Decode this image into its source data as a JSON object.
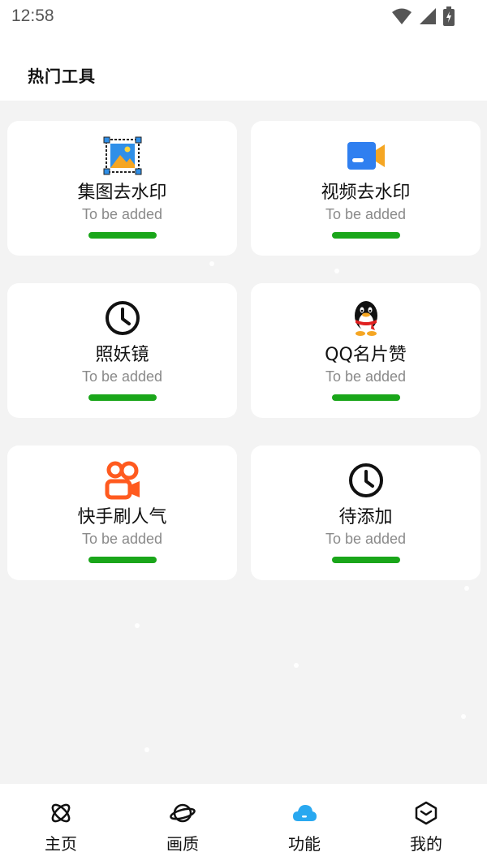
{
  "status": {
    "time": "12:58"
  },
  "header": {
    "title": "热门工具"
  },
  "cards": [
    {
      "title": "集图去水印",
      "subtitle": "To be added",
      "icon": "image-watermark-icon"
    },
    {
      "title": "视频去水印",
      "subtitle": "To be added",
      "icon": "video-camera-icon"
    },
    {
      "title": "照妖镜",
      "subtitle": "To be added",
      "icon": "clock-icon"
    },
    {
      "title": "QQ名片赞",
      "subtitle": "To be added",
      "icon": "qq-penguin-icon"
    },
    {
      "title": "快手刷人气",
      "subtitle": "To be added",
      "icon": "kuaishou-icon"
    },
    {
      "title": "待添加",
      "subtitle": "To be added",
      "icon": "clock-icon"
    }
  ],
  "nav": [
    {
      "label": "主页",
      "icon": "atom-icon",
      "active": false
    },
    {
      "label": "画质",
      "icon": "planet-icon",
      "active": false
    },
    {
      "label": "功能",
      "icon": "cloud-icon",
      "active": true
    },
    {
      "label": "我的",
      "icon": "cube-icon",
      "active": false
    }
  ],
  "colors": {
    "accent_bar": "#1aa61a",
    "active_nav": "#29a8f0",
    "background": "#f3f3f3"
  }
}
